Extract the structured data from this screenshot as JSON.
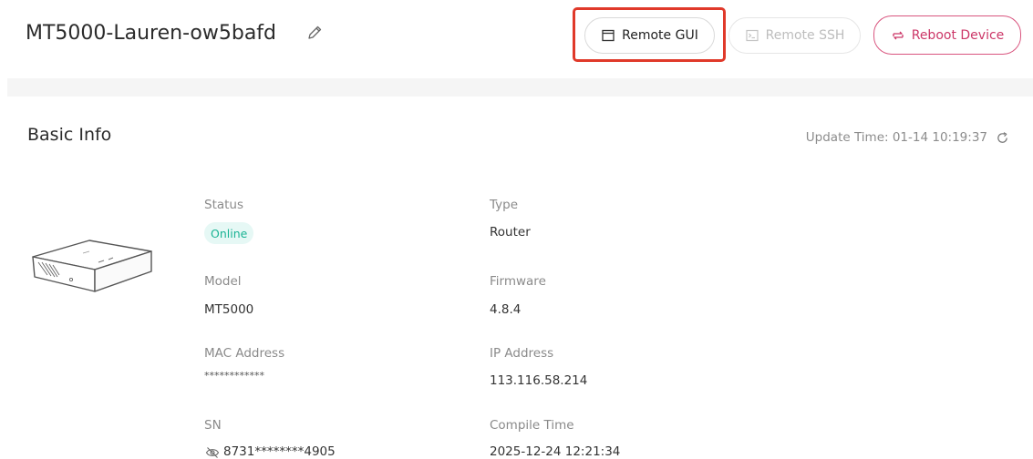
{
  "header": {
    "device_name": "MT5000-Lauren-ow5bafd",
    "buttons": {
      "remote_gui": "Remote GUI",
      "remote_ssh": "Remote SSH",
      "reboot": "Reboot Device"
    }
  },
  "basic_info": {
    "title": "Basic Info",
    "update_time": "Update Time: 01-14 10:19:37",
    "fields": {
      "status": {
        "label": "Status",
        "value": "Online"
      },
      "type": {
        "label": "Type",
        "value": "Router"
      },
      "model": {
        "label": "Model",
        "value": "MT5000"
      },
      "firmware": {
        "label": "Firmware",
        "value": "4.8.4"
      },
      "mac": {
        "label": "MAC Address",
        "value": "************"
      },
      "ip": {
        "label": "IP Address",
        "value": "113.116.58.214"
      },
      "sn": {
        "label": "SN",
        "value": "8731********4905"
      },
      "compile_time": {
        "label": "Compile Time",
        "value": "2025-12-24 12:21:34"
      }
    }
  },
  "colors": {
    "online_badge_bg": "#e6f8f5",
    "online_badge_text": "#1ab394",
    "reboot_accent": "#cc3768",
    "highlight_box": "#e0392a"
  },
  "icons": {
    "edit": "pencil-icon",
    "remote_gui": "window-icon",
    "remote_ssh": "terminal-icon",
    "reboot": "reboot-icon",
    "refresh": "refresh-icon",
    "sn_visibility": "eye-slash-icon"
  }
}
